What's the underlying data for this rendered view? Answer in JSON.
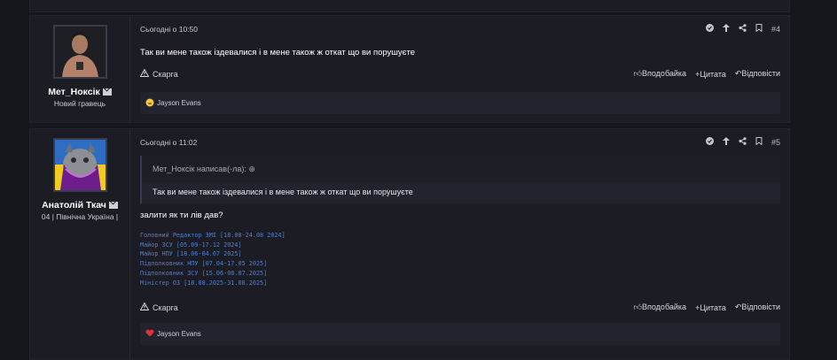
{
  "posts": [
    {
      "author": "Мет_Ноксік",
      "title": "Новий гравець",
      "date": "Сьогодні о 10:50",
      "number": "#4",
      "body": "Так ви мене також іздевалися і в мене також ж откат що ви порушуєте",
      "report": "Скарга",
      "like": "Вподобайка",
      "quote": "Цитата",
      "reply": "Відповісти",
      "reaction_user": "Jayson Evans"
    },
    {
      "author": "Анатолій Ткач",
      "title": "04 | Північна Україна |",
      "date": "Сьогодні о 11:02",
      "number": "#5",
      "quote_header": "Мет_Ноксік написав(-ла):",
      "quote_text": "Так ви мене також іздевалися і в мене також ж откат що ви порушуєте",
      "body": "залити як ти лів дав?",
      "signature": [
        "Головний Редактор ЗМІ [18.08-24.08 2024]",
        "Майор ЗСУ [05.09-17.12 2024]",
        "Майор НПУ [18.06-04.07 2025]",
        "Підполковник НПУ [07.04-17.05 2025]",
        "Підполковник ЗСУ [15.06-08.07.2025]",
        "Міністер ОЗ [18.08.2025-31.08.2025]"
      ],
      "report": "Скарга",
      "like": "Вподобайка",
      "quote": "Цитата",
      "reply": "Відповісти",
      "reaction_user": "Jayson Evans"
    }
  ],
  "colors": {
    "background": "#16161d",
    "panel": "#1c1c24",
    "signature": "#4f7fd6",
    "heart": "#e0313f"
  },
  "icons": [
    "check-circle-icon",
    "arrow-up-icon",
    "share-icon",
    "bookmark-icon",
    "warning-icon",
    "thumbs-up-icon",
    "plus-icon",
    "reply-icon",
    "mail-icon",
    "quote-arrow-icon",
    "heart-icon",
    "laugh-emoji-icon"
  ]
}
